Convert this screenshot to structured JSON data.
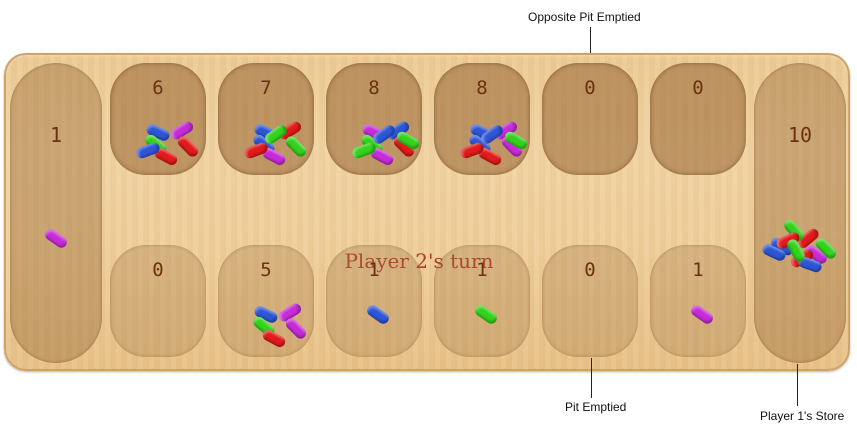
{
  "annotations": {
    "opposite_pit_emptied": "Opposite Pit Emptied",
    "pit_emptied": "Pit Emptied",
    "player1_store": "Player 1's Store"
  },
  "board": {
    "turn_text": "Player 2's turn",
    "left_store": {
      "count": "1",
      "beans": [
        "purple"
      ]
    },
    "right_store": {
      "count": "10",
      "beans": [
        "blue",
        "red",
        "green",
        "purple",
        "blue",
        "red",
        "green",
        "red",
        "blue",
        "green"
      ]
    },
    "top_pits": [
      {
        "count": "6",
        "beans": [
          "blue",
          "purple",
          "green",
          "red",
          "red",
          "blue"
        ]
      },
      {
        "count": "7",
        "beans": [
          "blue",
          "red",
          "blue",
          "purple",
          "green",
          "red",
          "green"
        ]
      },
      {
        "count": "8",
        "beans": [
          "purple",
          "blue",
          "green",
          "purple",
          "red",
          "green",
          "blue",
          "green"
        ]
      },
      {
        "count": "8",
        "beans": [
          "blue",
          "purple",
          "blue",
          "red",
          "purple",
          "red",
          "blue",
          "green"
        ]
      },
      {
        "count": "0",
        "beans": []
      },
      {
        "count": "0",
        "beans": []
      }
    ],
    "bottom_pits": [
      {
        "count": "0",
        "beans": []
      },
      {
        "count": "5",
        "beans": [
          "blue",
          "purple",
          "green",
          "red",
          "purple"
        ]
      },
      {
        "count": "1",
        "beans": [
          "blue"
        ]
      },
      {
        "count": "1",
        "beans": [
          "green"
        ]
      },
      {
        "count": "0",
        "beans": []
      },
      {
        "count": "1",
        "beans": [
          "purple"
        ]
      }
    ]
  },
  "colors": {
    "blue": "#2d56d6",
    "red": "#e11a1a",
    "green": "#33d21c",
    "purple": "#c62bd9",
    "count_text": "#6a3212",
    "turn_text": "#b23a2a"
  }
}
